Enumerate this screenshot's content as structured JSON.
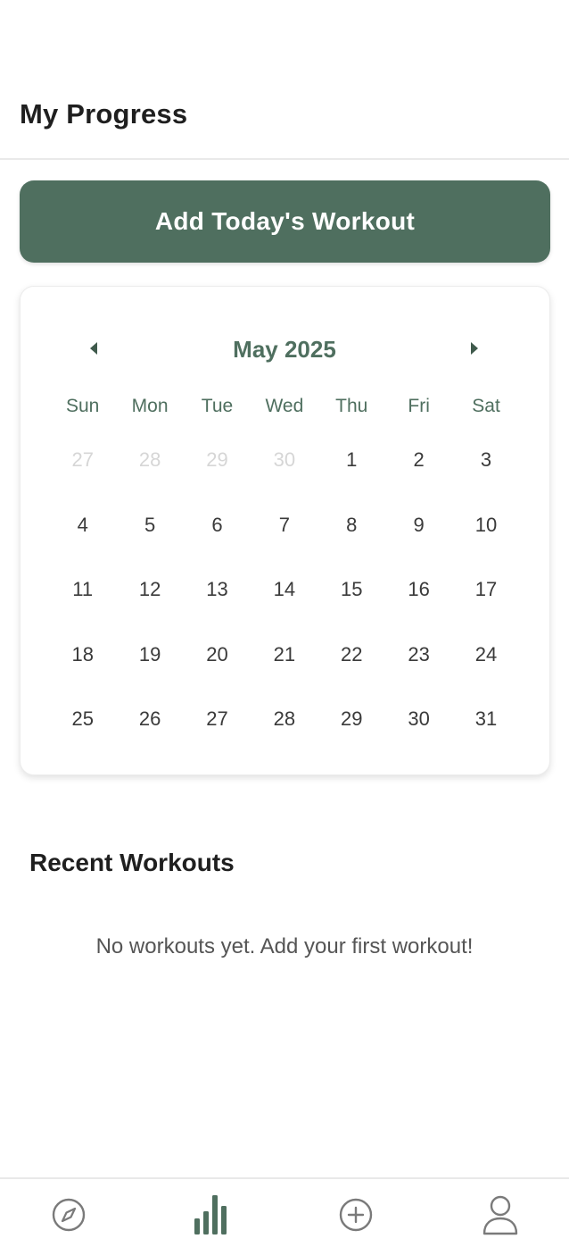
{
  "header": {
    "title": "My Progress"
  },
  "actions": {
    "add_workout_label": "Add Today's Workout"
  },
  "calendar": {
    "month_label": "May 2025",
    "weekdays": [
      "Sun",
      "Mon",
      "Tue",
      "Wed",
      "Thu",
      "Fri",
      "Sat"
    ],
    "weeks": [
      [
        "27",
        "28",
        "29",
        "30",
        "1",
        "2",
        "3"
      ],
      [
        "4",
        "5",
        "6",
        "7",
        "8",
        "9",
        "10"
      ],
      [
        "11",
        "12",
        "13",
        "14",
        "15",
        "16",
        "17"
      ],
      [
        "18",
        "19",
        "20",
        "21",
        "22",
        "23",
        "24"
      ],
      [
        "25",
        "26",
        "27",
        "28",
        "29",
        "30",
        "31"
      ]
    ],
    "prev_icon": "chevron-left-icon",
    "next_icon": "chevron-right-icon"
  },
  "recent": {
    "title": "Recent Workouts",
    "empty_text": "No workouts yet. Add your first workout!"
  },
  "nav": {
    "items": [
      {
        "icon": "compass-icon",
        "active": false
      },
      {
        "icon": "bar-chart-icon",
        "active": true
      },
      {
        "icon": "plus-circle-icon",
        "active": false
      },
      {
        "icon": "user-icon",
        "active": false
      }
    ]
  },
  "colors": {
    "accent": "#4f6f5f",
    "muted_day": "#d6d6d6",
    "nav_inactive": "#7a7a7a"
  }
}
